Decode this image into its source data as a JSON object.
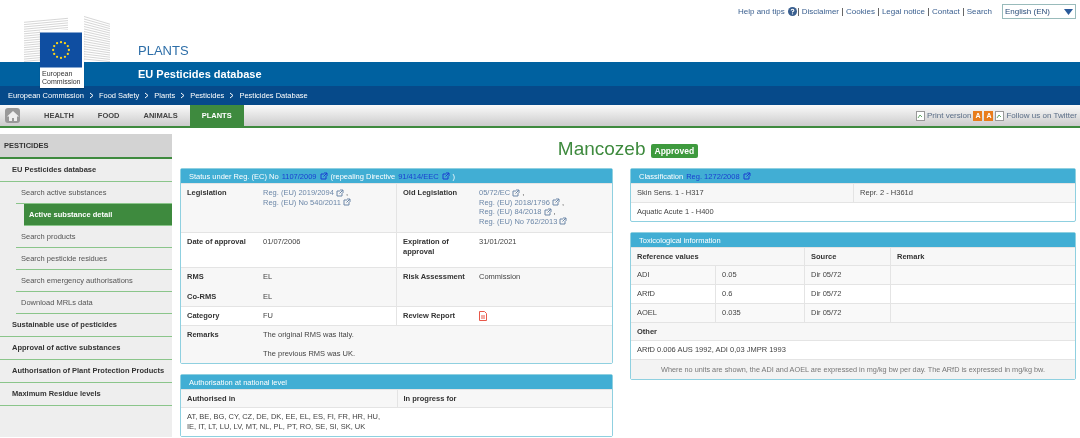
{
  "top_links": [
    {
      "kind": "link",
      "text": "Help and tips"
    },
    {
      "kind": "help_icon"
    },
    {
      "kind": "link",
      "text": "Disclaimer"
    },
    {
      "kind": "link",
      "text": "Cookies"
    },
    {
      "kind": "link",
      "text": "Legal notice"
    },
    {
      "kind": "link",
      "text": "Contact"
    },
    {
      "kind": "link",
      "text": "Search"
    }
  ],
  "language": "English (EN)",
  "logo_text": [
    "European",
    "Commission"
  ],
  "site_title": "PLANTS",
  "site_subtitle": "EU Pesticides database",
  "breadcrumb": [
    "European Commission",
    "Food Safety",
    "Plants",
    "Pesticides",
    "Pesticides Database"
  ],
  "nav_tabs": [
    {
      "label": "HEALTH",
      "selected": false
    },
    {
      "label": "FOOD",
      "selected": false
    },
    {
      "label": "ANIMALS",
      "selected": false
    },
    {
      "label": "PLANTS",
      "selected": true
    }
  ],
  "tools": {
    "print": "Print version",
    "font_buttons": [
      "A",
      "A"
    ],
    "twitter": "Follow us on Twitter"
  },
  "sidebar": {
    "title": "PESTICIDES",
    "items": [
      {
        "label": "EU Pesticides database",
        "selected": false,
        "children": [
          {
            "label": "Search active substances",
            "selected": false
          },
          {
            "label": "Active substance detail",
            "selected": true
          },
          {
            "label": "Search products",
            "selected": false
          },
          {
            "label": "Search pesticide residues",
            "selected": false
          },
          {
            "label": "Search emergency authorisations",
            "selected": false
          },
          {
            "label": "Download MRLs data",
            "selected": false
          }
        ]
      },
      {
        "label": "Sustainable use of pesticides",
        "selected": false
      },
      {
        "label": "Approval of active substances",
        "selected": false
      },
      {
        "label": "Authorisation of Plant Protection Products",
        "selected": false
      },
      {
        "label": "Maximum Residue levels",
        "selected": false
      }
    ]
  },
  "substance": {
    "name": "Mancozeb",
    "status": "Approved"
  },
  "status_panel": {
    "title": [
      {
        "kind": "text",
        "text": "Status under Reg. (EC) No"
      },
      {
        "kind": "link",
        "text": "1107/2009"
      },
      {
        "kind": "text",
        "text": "(repealing Directive"
      },
      {
        "kind": "link",
        "text": "91/414/EEC"
      },
      {
        "kind": "text",
        "text": ")"
      }
    ],
    "rows": [
      {
        "cells": [
          {
            "entries": [
              {
                "label": "Legislation",
                "kind": "links",
                "links": [
                  {
                    "text": "Reg. (EU) 2019/2094",
                    "sep": ","
                  },
                  {
                    "text": "Reg. (EU) No 540/2011"
                  }
                ]
              }
            ]
          },
          {
            "entries": [
              {
                "label": "Old Legislation",
                "kind": "links",
                "links": [
                  {
                    "text": "05/72/EC",
                    "sep": ","
                  },
                  {
                    "text": "Reg. (EU) 2018/1796",
                    "sep": ","
                  },
                  {
                    "text": "Reg. (EU) 84/2018",
                    "sep": ","
                  },
                  {
                    "text": "Reg. (EU) No 762/2013"
                  }
                ]
              }
            ]
          }
        ]
      },
      {
        "cells": [
          {
            "entries": [
              {
                "label": "Date of approval",
                "kind": "text",
                "values": [
                  "01/07/2006"
                ]
              }
            ]
          },
          {
            "entries": [
              {
                "label": "Expiration of approval",
                "kind": "text",
                "values": [
                  "31/01/2021"
                ]
              }
            ]
          }
        ]
      },
      {
        "cells": [
          {
            "entries": [
              {
                "label": "RMS",
                "kind": "text",
                "values": [
                  "EL"
                ]
              },
              {
                "label": "Co-RMS",
                "kind": "text",
                "values": [
                  "EL"
                ]
              }
            ]
          },
          {
            "entries": [
              {
                "label": "Risk Assessment",
                "kind": "text",
                "values": [
                  "Commission"
                ]
              }
            ]
          }
        ]
      },
      {
        "cells": [
          {
            "entries": [
              {
                "label": "Category",
                "kind": "text",
                "values": [
                  "FU"
                ]
              }
            ]
          },
          {
            "entries": [
              {
                "label": "Review Report",
                "kind": "pdf"
              }
            ]
          }
        ]
      },
      {
        "cells": [
          {
            "entries": [
              {
                "label": "Remarks",
                "kind": "text",
                "values": [
                  "The original RMS was Italy.",
                  "The previous RMS was UK."
                ]
              }
            ]
          }
        ]
      }
    ]
  },
  "national_panel": {
    "title": "Authorisation at national level",
    "columns": [
      "Authorised in",
      "In progress for"
    ],
    "values": [
      "AT, BE, BG, CY, CZ, DE, DK, EE, EL, ES, FI, FR, HR, HU, IE, IT, LT, LU, LV, MT, NL, PL, PT, RO, SE, SI, SK, UK"
    ]
  },
  "classification_panel": {
    "title": "Classification",
    "link": "Reg. 1272/2008",
    "rows": [
      [
        "Skin Sens. 1 - H317",
        "Repr. 2 - H361d"
      ],
      [
        "Aquatic Acute 1 - H400"
      ]
    ]
  },
  "tox_panel": {
    "title": "Toxicological information",
    "columns": [
      "Reference values",
      "",
      "Source",
      "Remark"
    ],
    "rows": [
      [
        "ADI",
        "0.05",
        "Dir 05/72"
      ],
      [
        "ARfD",
        "0.6",
        "Dir 05/72"
      ],
      [
        "AOEL",
        "0.035",
        "Dir 05/72"
      ]
    ],
    "other_label": "Other",
    "other": "ARfD 0.006 AUS 1992, ADI 0,03 JMPR 1993",
    "note": "Where no units are shown, the ADI and AOEL are expressed in mg/kg bw per day. The ARfD is expressed in mg/kg bw."
  }
}
